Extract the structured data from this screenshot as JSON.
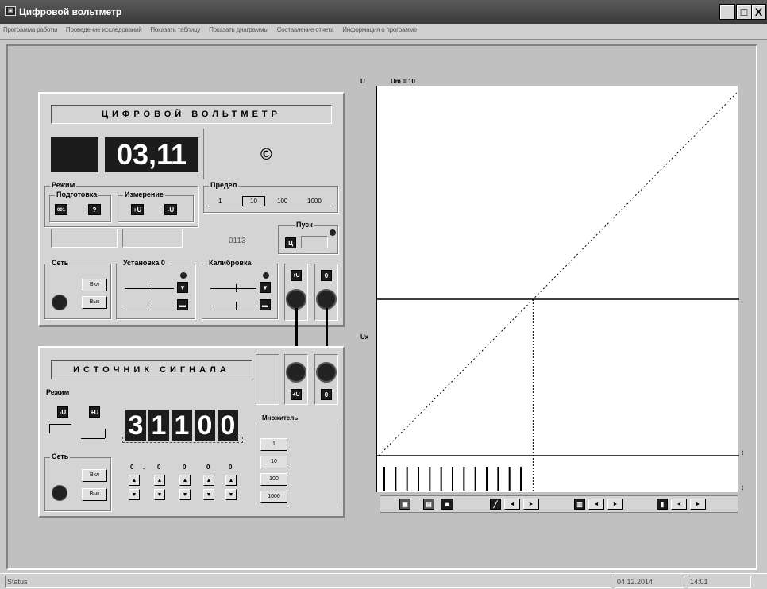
{
  "window": {
    "title": "Цифровой вольтметр",
    "minimize": "_",
    "maximize": "□",
    "close": "X"
  },
  "menu": [
    "Программа работы",
    "Проведение исследований",
    "Показать таблицу",
    "Показать диаграммы",
    "Составление отчета",
    "Информация о программе"
  ],
  "voltmeter": {
    "title": "ЦИФРОВОЙ ВОЛЬТМЕТР",
    "display": "03,11",
    "copyright": "©",
    "modes_label": "Режим",
    "prep_label": "Подготовка",
    "measure_label": "Измерение",
    "prep_btn1": "001",
    "prep_btn2": "?",
    "measure_btn1": "+U",
    "measure_btn2": "-U",
    "limit_label": "Предел",
    "limits": [
      "1",
      "10",
      "100",
      "1000"
    ],
    "counter": "0113",
    "start_label": "Пуск",
    "start_btn": "Ц",
    "power_label": "Сеть",
    "on": "Вкл",
    "off": "Вык",
    "zero_label": "Установка 0",
    "calib_label": "Калибровка",
    "jack_plus": "+U",
    "jack_zero": "0"
  },
  "source": {
    "title": "ИСТОЧНИК СИГНАЛА",
    "modes_label": "Режим",
    "mode_btn1": "-U",
    "mode_btn2": "+U",
    "digits": [
      "3",
      "1",
      "1",
      "0",
      "0"
    ],
    "multiplier_label": "Множитель",
    "multipliers": [
      "1",
      "10",
      "100",
      "1000"
    ],
    "power_label": "Сеть",
    "on": "Вкл",
    "off": "Вык",
    "step_values": [
      "0",
      ".",
      "0",
      "0",
      "0",
      "0"
    ],
    "jack_plus": "+U",
    "jack_zero": "0"
  },
  "chart_labels": {
    "u_axis": "U",
    "um": "Um = 10",
    "ux": "Ux",
    "t1": "t",
    "t2": "t"
  },
  "chart_data": {
    "type": "line",
    "title": "Um = 10",
    "ylabel": "U",
    "xlabel": "t",
    "series": [
      {
        "values": [
          0,
          10
        ]
      },
      {
        "values": [
          4.3,
          4.3
        ]
      }
    ],
    "pulse_count": 13
  },
  "chart_toolbar": {
    "arrow_left": "◄",
    "arrow_right": "►"
  },
  "status": {
    "text": "Status",
    "date": "04.12.2014",
    "time": "14:01"
  }
}
